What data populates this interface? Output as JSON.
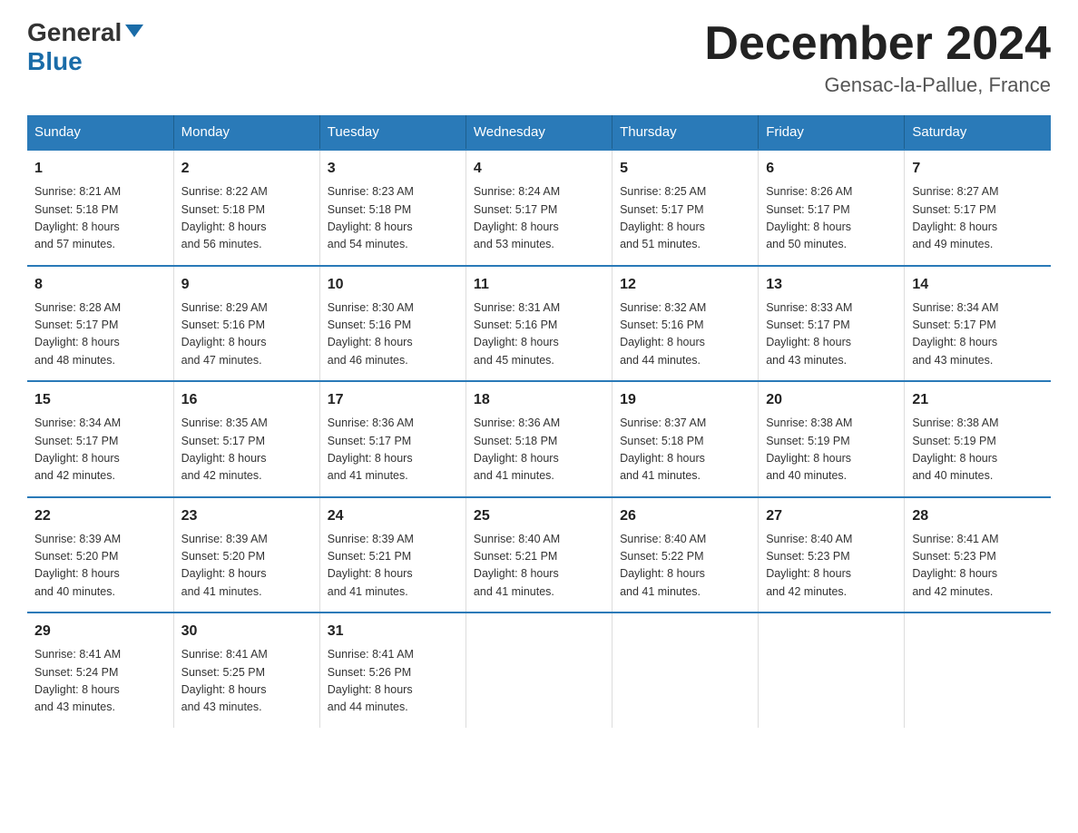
{
  "logo": {
    "general": "General",
    "blue": "Blue"
  },
  "title": "December 2024",
  "location": "Gensac-la-Pallue, France",
  "weekdays": [
    "Sunday",
    "Monday",
    "Tuesday",
    "Wednesday",
    "Thursday",
    "Friday",
    "Saturday"
  ],
  "weeks": [
    [
      {
        "day": "1",
        "sunrise": "8:21 AM",
        "sunset": "5:18 PM",
        "daylight": "8 hours and 57 minutes."
      },
      {
        "day": "2",
        "sunrise": "8:22 AM",
        "sunset": "5:18 PM",
        "daylight": "8 hours and 56 minutes."
      },
      {
        "day": "3",
        "sunrise": "8:23 AM",
        "sunset": "5:18 PM",
        "daylight": "8 hours and 54 minutes."
      },
      {
        "day": "4",
        "sunrise": "8:24 AM",
        "sunset": "5:17 PM",
        "daylight": "8 hours and 53 minutes."
      },
      {
        "day": "5",
        "sunrise": "8:25 AM",
        "sunset": "5:17 PM",
        "daylight": "8 hours and 51 minutes."
      },
      {
        "day": "6",
        "sunrise": "8:26 AM",
        "sunset": "5:17 PM",
        "daylight": "8 hours and 50 minutes."
      },
      {
        "day": "7",
        "sunrise": "8:27 AM",
        "sunset": "5:17 PM",
        "daylight": "8 hours and 49 minutes."
      }
    ],
    [
      {
        "day": "8",
        "sunrise": "8:28 AM",
        "sunset": "5:17 PM",
        "daylight": "8 hours and 48 minutes."
      },
      {
        "day": "9",
        "sunrise": "8:29 AM",
        "sunset": "5:16 PM",
        "daylight": "8 hours and 47 minutes."
      },
      {
        "day": "10",
        "sunrise": "8:30 AM",
        "sunset": "5:16 PM",
        "daylight": "8 hours and 46 minutes."
      },
      {
        "day": "11",
        "sunrise": "8:31 AM",
        "sunset": "5:16 PM",
        "daylight": "8 hours and 45 minutes."
      },
      {
        "day": "12",
        "sunrise": "8:32 AM",
        "sunset": "5:16 PM",
        "daylight": "8 hours and 44 minutes."
      },
      {
        "day": "13",
        "sunrise": "8:33 AM",
        "sunset": "5:17 PM",
        "daylight": "8 hours and 43 minutes."
      },
      {
        "day": "14",
        "sunrise": "8:34 AM",
        "sunset": "5:17 PM",
        "daylight": "8 hours and 43 minutes."
      }
    ],
    [
      {
        "day": "15",
        "sunrise": "8:34 AM",
        "sunset": "5:17 PM",
        "daylight": "8 hours and 42 minutes."
      },
      {
        "day": "16",
        "sunrise": "8:35 AM",
        "sunset": "5:17 PM",
        "daylight": "8 hours and 42 minutes."
      },
      {
        "day": "17",
        "sunrise": "8:36 AM",
        "sunset": "5:17 PM",
        "daylight": "8 hours and 41 minutes."
      },
      {
        "day": "18",
        "sunrise": "8:36 AM",
        "sunset": "5:18 PM",
        "daylight": "8 hours and 41 minutes."
      },
      {
        "day": "19",
        "sunrise": "8:37 AM",
        "sunset": "5:18 PM",
        "daylight": "8 hours and 41 minutes."
      },
      {
        "day": "20",
        "sunrise": "8:38 AM",
        "sunset": "5:19 PM",
        "daylight": "8 hours and 40 minutes."
      },
      {
        "day": "21",
        "sunrise": "8:38 AM",
        "sunset": "5:19 PM",
        "daylight": "8 hours and 40 minutes."
      }
    ],
    [
      {
        "day": "22",
        "sunrise": "8:39 AM",
        "sunset": "5:20 PM",
        "daylight": "8 hours and 40 minutes."
      },
      {
        "day": "23",
        "sunrise": "8:39 AM",
        "sunset": "5:20 PM",
        "daylight": "8 hours and 41 minutes."
      },
      {
        "day": "24",
        "sunrise": "8:39 AM",
        "sunset": "5:21 PM",
        "daylight": "8 hours and 41 minutes."
      },
      {
        "day": "25",
        "sunrise": "8:40 AM",
        "sunset": "5:21 PM",
        "daylight": "8 hours and 41 minutes."
      },
      {
        "day": "26",
        "sunrise": "8:40 AM",
        "sunset": "5:22 PM",
        "daylight": "8 hours and 41 minutes."
      },
      {
        "day": "27",
        "sunrise": "8:40 AM",
        "sunset": "5:23 PM",
        "daylight": "8 hours and 42 minutes."
      },
      {
        "day": "28",
        "sunrise": "8:41 AM",
        "sunset": "5:23 PM",
        "daylight": "8 hours and 42 minutes."
      }
    ],
    [
      {
        "day": "29",
        "sunrise": "8:41 AM",
        "sunset": "5:24 PM",
        "daylight": "8 hours and 43 minutes."
      },
      {
        "day": "30",
        "sunrise": "8:41 AM",
        "sunset": "5:25 PM",
        "daylight": "8 hours and 43 minutes."
      },
      {
        "day": "31",
        "sunrise": "8:41 AM",
        "sunset": "5:26 PM",
        "daylight": "8 hours and 44 minutes."
      },
      null,
      null,
      null,
      null
    ]
  ],
  "labels": {
    "sunrise": "Sunrise:",
    "sunset": "Sunset:",
    "daylight": "Daylight:"
  }
}
